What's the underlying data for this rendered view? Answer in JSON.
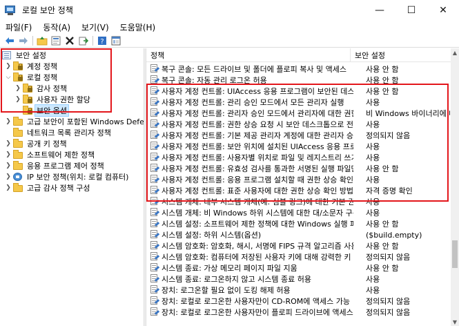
{
  "window": {
    "title": "로컬 보안 정책",
    "minimize": "—",
    "maximize": "☐",
    "close": "✕"
  },
  "menu": [
    "파일(F)",
    "동작(A)",
    "보기(V)",
    "도움말(H)"
  ],
  "toolbar": {
    "icons": [
      "back-arrow-icon",
      "forward-arrow-icon",
      "up-folder-icon",
      "properties-icon",
      "delete-icon",
      "export-icon",
      "help-icon",
      "console-tree-icon"
    ]
  },
  "tree": {
    "root": "보안 설정",
    "nodes": [
      {
        "label": "계정 정책"
      },
      {
        "label": "로컬 정책"
      },
      {
        "label": "감사 정책"
      },
      {
        "label": "사용자 권한 할당"
      },
      {
        "label": "보안 옵션"
      },
      {
        "label": "고급 보안이 포함된 Windows Defender"
      },
      {
        "label": "네트워크 목록 관리자 정책"
      },
      {
        "label": "공개 키 정책"
      },
      {
        "label": "소프트웨어 제한 정책"
      },
      {
        "label": "응용 프로그램 제어 정책"
      },
      {
        "label": "IP 보안 정책(위치: 로컬 컴퓨터)"
      },
      {
        "label": "고급 감사 정책 구성"
      }
    ]
  },
  "list": {
    "col_policy": "정책",
    "col_setting": "보안 설정",
    "rows": [
      {
        "policy": "복구 콘솔: 모든 드라이브 및 폴더에 플로피 복사 및 액세스",
        "setting": "사용 안 함"
      },
      {
        "policy": "복구 콘솔: 자동 관리 로그온 허용",
        "setting": "사용 안 함"
      },
      {
        "policy": "사용자 계정 컨트롤: UIAccess 응용 프로그램이 보안된 데스크톱을",
        "setting": "사용 안 함"
      },
      {
        "policy": "사용자 계정 컨트롤: 관리 승인 모드에서 모든 관리자 실행",
        "setting": "사용"
      },
      {
        "policy": "사용자 계정 컨트롤: 관리자 승인 모드에서 관리자에 대한 권한 상승",
        "setting": "비 Windows 바이너리에 대해 동의 확인"
      },
      {
        "policy": "사용자 계정 컨트롤: 권한 상승 요청 시 보안 데스크톱으로 전환",
        "setting": "사용"
      },
      {
        "policy": "사용자 계정 컨트롤: 기본 제공 관리자 계정에 대한 관리자 승인 모드",
        "setting": "정의되지 않음"
      },
      {
        "policy": "사용자 계정 컨트롤: 보안 위치에 설치된 UIAccess 응용 프로그램만",
        "setting": "사용"
      },
      {
        "policy": "사용자 계정 컨트롤: 사용자별 위치로 파일 및 레지스트리 쓰기 실패",
        "setting": "사용"
      },
      {
        "policy": "사용자 계정 컨트롤: 유효성 검사를 통과한 서명된 실행 파일만",
        "setting": "사용 안 함"
      },
      {
        "policy": "사용자 계정 컨트롤: 응용 프로그램 설치할 때 권한 상승 확인",
        "setting": "사용"
      },
      {
        "policy": "사용자 계정 컨트롤: 표준 사용자에 대한 권한 상승 확인 방법",
        "setting": "자격 증명 확인"
      },
      {
        "policy": "시스템 개체: 내부 시스템 개체(예: 심볼 링크)에 대한 기본 권한 강화",
        "setting": "사용"
      },
      {
        "policy": "시스템 개체: 비 Windows 하위 시스템에 대한 대/소문자 구분 안 함",
        "setting": "사용"
      },
      {
        "policy": "시스템 설정: 소프트웨어 제한 정책에 대한 Windows 실행 파일의",
        "setting": "사용 안 함"
      },
      {
        "policy": "시스템 설정: 하위 시스템(옵션)",
        "setting": "($build.empty)"
      },
      {
        "policy": "시스템 암호화: 암호화, 해시, 서명에 FIPS 규격 알고리즘 사용",
        "setting": "사용 안 함"
      },
      {
        "policy": "시스템 암호화: 컴퓨터에 저장된 사용자 키에 대해 강력한 키 보호",
        "setting": "정의되지 않음"
      },
      {
        "policy": "시스템 종료: 가상 메모리 페이지 파일 지움",
        "setting": "사용 안 함"
      },
      {
        "policy": "시스템 종료: 로그온하지 않고 시스템 종료 허용",
        "setting": "사용"
      },
      {
        "policy": "장치: 로그온할 필요 없이 도킹 해제 허용",
        "setting": "사용"
      },
      {
        "policy": "장치: 로컬로 로그온한 사용자만이 CD-ROM에 액세스 가능",
        "setting": "정의되지 않음"
      },
      {
        "policy": "장치: 로컬로 로그온한 사용자만이 플로피 드라이브에 액세스 가능",
        "setting": "정의되지 않음"
      }
    ]
  },
  "highlight_color": "#e3151a",
  "selection_color": "#cce8ff"
}
